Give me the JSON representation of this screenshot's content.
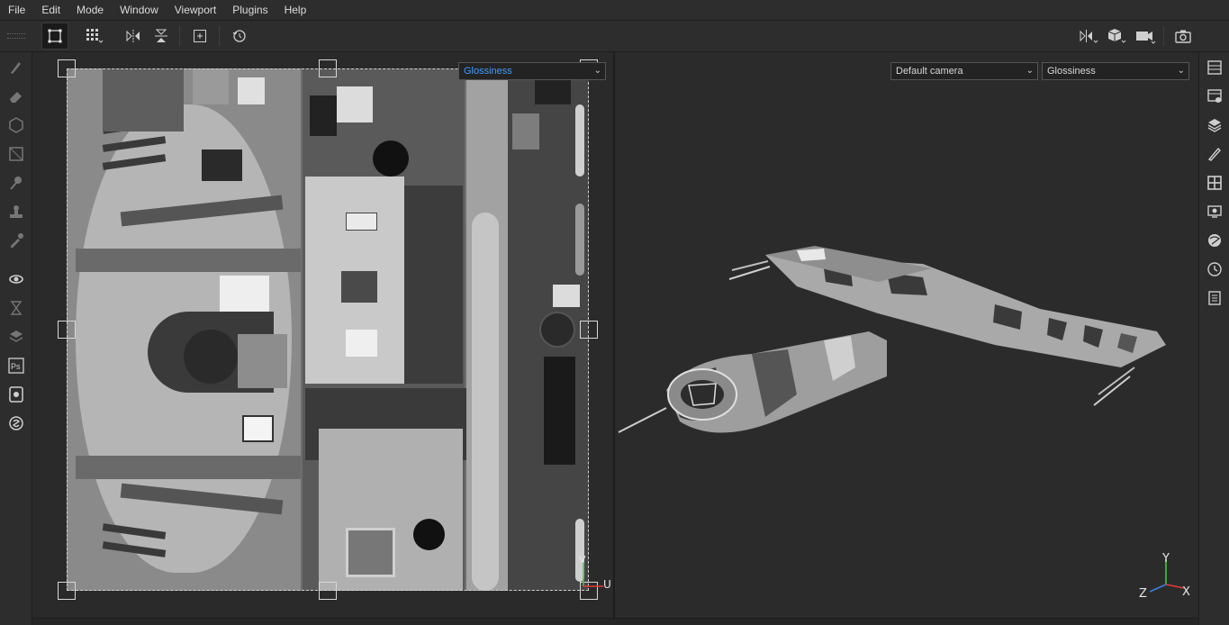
{
  "menu": {
    "items": [
      "File",
      "Edit",
      "Mode",
      "Window",
      "Viewport",
      "Plugins",
      "Help"
    ]
  },
  "toolbar": {
    "tools": [
      {
        "name": "uv-select-icon",
        "active": true
      },
      {
        "name": "grid-tiling-icon",
        "active": false
      },
      {
        "name": "flip-horizontal-icon",
        "active": false
      },
      {
        "name": "flip-vertical-icon",
        "active": false
      },
      {
        "name": "fit-view-icon",
        "active": false
      },
      {
        "name": "reset-view-icon",
        "active": false
      }
    ],
    "right_tools": [
      "mirror-axis-icon",
      "display-cube-icon",
      "camera-icon",
      "screenshot-icon"
    ]
  },
  "left_tools": [
    "paint-brush-icon",
    "eraser-icon",
    "projection-icon",
    "geometry-decal-icon",
    "smudge-icon",
    "clone-stamp-icon",
    "color-picker-icon",
    "bake-icon",
    "hourglass-icon",
    "layer-icon",
    "photoshop-icon",
    "iray-icon",
    "substance-icon"
  ],
  "right_panels": [
    "layers-list-icon",
    "texture-set-icon",
    "layer-stack-icon",
    "brush-settings-icon",
    "display-grid-icon",
    "viewer-settings-icon",
    "environment-icon",
    "history-icon",
    "log-icon"
  ],
  "viewport_2d": {
    "channel_select": "Glossiness",
    "uv_axis_u": "U",
    "uv_axis_v": "V"
  },
  "viewport_3d": {
    "camera_select": "Default camera",
    "channel_select": "Glossiness",
    "gizmo": {
      "x": "X",
      "y": "Y",
      "z": "Z"
    }
  },
  "colors": {
    "background": "#2b2b2b",
    "panel": "#2d2d2d",
    "accent_blue": "#3f9bff",
    "gizmo_x": "#e23b3b",
    "gizmo_y": "#49c24a",
    "gizmo_z": "#3b7fe2"
  }
}
